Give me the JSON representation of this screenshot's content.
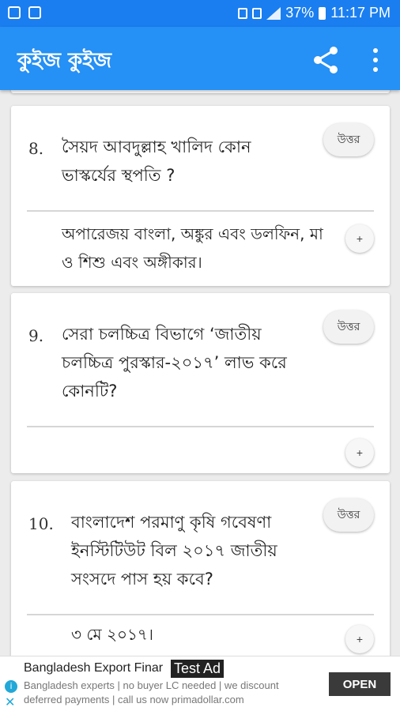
{
  "status_bar": {
    "battery": "37%",
    "time": "11:17 PM"
  },
  "app_bar": {
    "title": "কুইজ কুইজ",
    "share_icon": "share-icon",
    "more_icon": "more-vert-icon"
  },
  "questions": [
    {
      "number": "8.",
      "question": "সৈয়দ আবদুল্লাহ খালিদ কোন ভাস্কর্যের স্থপতি ?",
      "answer_button": "উত্তর",
      "answer": "অপারেজয় বাংলা, অঙ্কুর এবং ডলফিন, মা ও শিশু এবং অঙ্গীকার।",
      "toggle": "+"
    },
    {
      "number": "9.",
      "question": "সেরা চলচ্চিত্র বিভাগে ‘জাতীয় চলচ্চিত্র পুরস্কার-২০১৭’ লাভ করে কোনটি?",
      "answer_button": "উত্তর",
      "answer": "",
      "toggle": "+"
    },
    {
      "number": "10.",
      "question": "বাংলাদেশ পরমাণু কৃষি গবেষণা ইনস্টিটিউট বিল ২০১৭ জাতীয় সংসদে পাস হয় কবে?",
      "answer_button": "উত্তর",
      "answer": "৩ মে ২০১৭।",
      "toggle": "+"
    }
  ],
  "ad": {
    "title": "Bangladesh Export Finar",
    "tag": "Test Ad",
    "description": "Bangladesh experts | no buyer LC needed | we discount deferred payments | call us now primadollar.com",
    "cta": "OPEN",
    "info_icon": "i",
    "close_icon": "✕"
  }
}
